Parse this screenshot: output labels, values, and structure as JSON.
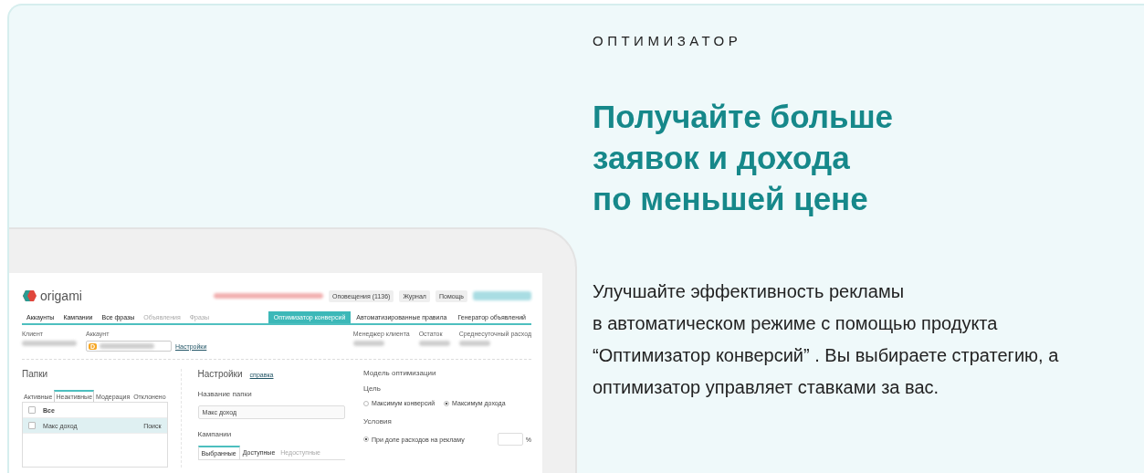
{
  "app_screen": {
    "logo": "origami",
    "top_buttons": [
      "Оповещения (1136)",
      "Журнал",
      "Помощь"
    ],
    "nav_tabs": [
      {
        "label": "Аккаунты",
        "disabled": false
      },
      {
        "label": "Кампании",
        "disabled": false
      },
      {
        "label": "Все фразы",
        "disabled": false
      },
      {
        "label": "Объявления",
        "disabled": true
      },
      {
        "label": "Фразы",
        "disabled": true
      }
    ],
    "tool_tabs": [
      {
        "label": "Оптимизатор конверсий",
        "selected": true
      },
      {
        "label": "Автоматизированные правила",
        "selected": false
      },
      {
        "label": "Генератор объявлений",
        "selected": false
      }
    ],
    "client_label": "Клиент",
    "account_label": "Аккаунт",
    "account_badge": "D",
    "settings_link": "Настройки",
    "info_labels": [
      "Менеджер клиента",
      "Остаток",
      "Среднесуточный расход"
    ],
    "folders": {
      "title": "Папки",
      "tabs": [
        {
          "label": "Активные",
          "selected": false
        },
        {
          "label": "Неактивные",
          "selected": true
        },
        {
          "label": "Модерация",
          "selected": false
        },
        {
          "label": "Отклонено",
          "selected": false
        }
      ],
      "header": {
        "label": "Все",
        "checked": false
      },
      "rows": [
        {
          "name": "Макс доход",
          "type": "Поиск",
          "checked": false,
          "selected": true
        }
      ]
    },
    "settings": {
      "title": "Настройки",
      "help_link": "справка",
      "folder_name_label": "Название папки",
      "folder_name_value": "Макс доход",
      "campaigns_label": "Кампании",
      "campaign_tabs": [
        {
          "label": "Выбранные",
          "selected": true,
          "disabled": false
        },
        {
          "label": "Доступные",
          "selected": false,
          "disabled": false
        },
        {
          "label": "Недоступные",
          "selected": false,
          "disabled": true
        }
      ]
    },
    "model": {
      "title": "Модель оптимизации",
      "goal_label": "Цель",
      "goals": [
        {
          "label": "Максимум конверсий",
          "selected": false
        },
        {
          "label": "Максимум дохода",
          "selected": true
        }
      ],
      "conditions_label": "Условия",
      "conditions": [
        {
          "label": "При доле расходов на рекламу",
          "selected": true,
          "unit": "%"
        }
      ]
    }
  },
  "eyebrow": "ОПТИМИЗАТОР",
  "headline": "Получайте больше\nзаявок и дохода\nпо меньшей цене",
  "description": "Улучшайте эффективность рекламы\nв автоматическом режиме с помощью продукта “Оптимизатор конверсий” . Вы выбираете стратегию, а оптимизатор управляет ставками за вас."
}
